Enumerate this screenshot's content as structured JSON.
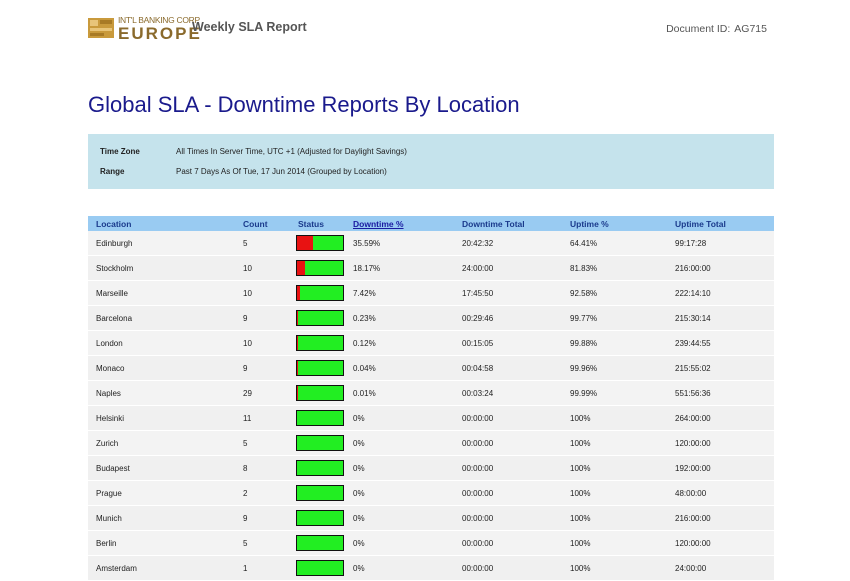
{
  "header": {
    "logo_top": "INT'L BANKING CORP",
    "logo_main": "EUROPE",
    "report_title": "Weekly SLA Report",
    "doc_id_label": "Document ID:",
    "doc_id_value": "AG715"
  },
  "page_title": "Global SLA - Downtime Reports By Location",
  "info": {
    "timezone_label": "Time Zone",
    "timezone_value": "All Times In Server Time, UTC +1 (Adjusted for Daylight Savings)",
    "range_label": "Range",
    "range_value": "Past 7 Days As Of Tue, 17 Jun 2014 (Grouped by Location)"
  },
  "table": {
    "columns": {
      "location": "Location",
      "count": "Count",
      "status": "Status",
      "downtime_pct": "Downtime %",
      "downtime_total": "Downtime Total",
      "uptime_pct": "Uptime %",
      "uptime_total": "Uptime Total"
    },
    "rows": [
      {
        "location": "Edinburgh",
        "count": "5",
        "downtime_pct": "35.59%",
        "downtime_total": "20:42:32",
        "uptime_pct": "64.41%",
        "uptime_total": "99:17:28",
        "status_down_fraction": 0.3559
      },
      {
        "location": "Stockholm",
        "count": "10",
        "downtime_pct": "18.17%",
        "downtime_total": "24:00:00",
        "uptime_pct": "81.83%",
        "uptime_total": "216:00:00",
        "status_down_fraction": 0.1817
      },
      {
        "location": "Marseille",
        "count": "10",
        "downtime_pct": "7.42%",
        "downtime_total": "17:45:50",
        "uptime_pct": "92.58%",
        "uptime_total": "222:14:10",
        "status_down_fraction": 0.0742
      },
      {
        "location": "Barcelona",
        "count": "9",
        "downtime_pct": "0.23%",
        "downtime_total": "00:29:46",
        "uptime_pct": "99.77%",
        "uptime_total": "215:30:14",
        "status_down_fraction": 0.0023
      },
      {
        "location": "London",
        "count": "10",
        "downtime_pct": "0.12%",
        "downtime_total": "00:15:05",
        "uptime_pct": "99.88%",
        "uptime_total": "239:44:55",
        "status_down_fraction": 0.0012
      },
      {
        "location": "Monaco",
        "count": "9",
        "downtime_pct": "0.04%",
        "downtime_total": "00:04:58",
        "uptime_pct": "99.96%",
        "uptime_total": "215:55:02",
        "status_down_fraction": 0.0004
      },
      {
        "location": "Naples",
        "count": "29",
        "downtime_pct": "0.01%",
        "downtime_total": "00:03:24",
        "uptime_pct": "99.99%",
        "uptime_total": "551:56:36",
        "status_down_fraction": 0.0001
      },
      {
        "location": "Helsinki",
        "count": "11",
        "downtime_pct": "0%",
        "downtime_total": "00:00:00",
        "uptime_pct": "100%",
        "uptime_total": "264:00:00",
        "status_down_fraction": 0
      },
      {
        "location": "Zurich",
        "count": "5",
        "downtime_pct": "0%",
        "downtime_total": "00:00:00",
        "uptime_pct": "100%",
        "uptime_total": "120:00:00",
        "status_down_fraction": 0
      },
      {
        "location": "Budapest",
        "count": "8",
        "downtime_pct": "0%",
        "downtime_total": "00:00:00",
        "uptime_pct": "100%",
        "uptime_total": "192:00:00",
        "status_down_fraction": 0
      },
      {
        "location": "Prague",
        "count": "2",
        "downtime_pct": "0%",
        "downtime_total": "00:00:00",
        "uptime_pct": "100%",
        "uptime_total": "48:00:00",
        "status_down_fraction": 0
      },
      {
        "location": "Munich",
        "count": "9",
        "downtime_pct": "0%",
        "downtime_total": "00:00:00",
        "uptime_pct": "100%",
        "uptime_total": "216:00:00",
        "status_down_fraction": 0
      },
      {
        "location": "Berlin",
        "count": "5",
        "downtime_pct": "0%",
        "downtime_total": "00:00:00",
        "uptime_pct": "100%",
        "uptime_total": "120:00:00",
        "status_down_fraction": 0
      },
      {
        "location": "Amsterdam",
        "count": "1",
        "downtime_pct": "0%",
        "downtime_total": "00:00:00",
        "uptime_pct": "100%",
        "uptime_total": "24:00:00",
        "status_down_fraction": 0
      }
    ]
  },
  "colors": {
    "title": "#1a1a8c",
    "header_row": "#99cbf2",
    "info_box": "#c5e3ec",
    "status_up": "#22ee22",
    "status_down": "#e81212"
  }
}
